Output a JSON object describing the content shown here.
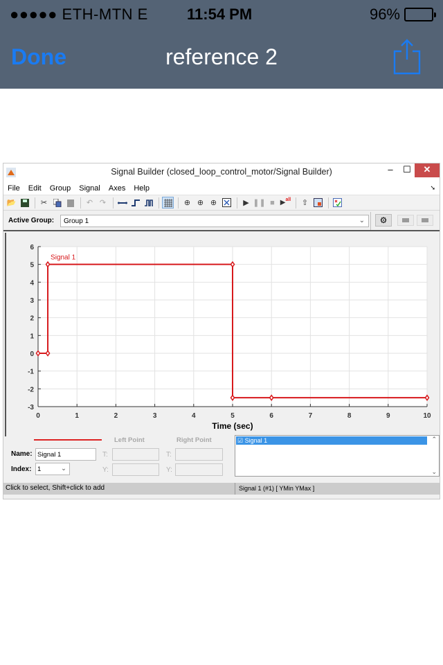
{
  "status_bar": {
    "carrier": "●●●●● ETH-MTN   E",
    "time": "11:54 PM",
    "battery": "96%",
    "battery_level": 0.96
  },
  "nav": {
    "done_label": "Done",
    "title": "reference 2"
  },
  "window": {
    "title": "Signal Builder (closed_loop_control_motor/Signal Builder)",
    "controls": {
      "minimize": "–",
      "maximize": "☐",
      "close": "✕"
    },
    "menu": [
      "File",
      "Edit",
      "Group",
      "Signal",
      "Axes",
      "Help"
    ],
    "toolbar_icons": [
      "open-icon",
      "save-icon",
      "cut-icon",
      "copy-icon",
      "paste-icon",
      "undo-icon",
      "redo-icon",
      "constant-icon",
      "step-icon",
      "pulse-icon",
      "grid-icon",
      "zoom-x-icon",
      "zoom-y-icon",
      "zoom-xy-icon",
      "fit-icon",
      "play-icon",
      "pause-icon",
      "stop-icon",
      "play-all-icon",
      "up-icon",
      "export-icon",
      "verify-icon"
    ],
    "active_group_label": "Active Group:",
    "active_group_value": "Group 1",
    "bottom": {
      "left_point_label": "Left Point",
      "right_point_label": "Right Point",
      "name_label": "Name:",
      "name_value": "Signal 1",
      "index_label": "Index:",
      "index_value": "1",
      "t_label": "T:",
      "y_label": "Y:",
      "signal_list": [
        "☑ Signal 1"
      ]
    },
    "status_left": "Click to select, Shift+click to add",
    "status_right": "Signal 1 (#1)  [ YMin YMax ]"
  },
  "chart_data": {
    "type": "line",
    "title": "",
    "xlabel": "Time (sec)",
    "ylabel": "",
    "xlim": [
      0,
      10
    ],
    "ylim": [
      -3,
      6
    ],
    "xticks": [
      0,
      1,
      2,
      3,
      4,
      5,
      6,
      7,
      8,
      9,
      10
    ],
    "yticks": [
      -3,
      -2,
      -1,
      0,
      1,
      2,
      3,
      4,
      5,
      6
    ],
    "grid": true,
    "series": [
      {
        "name": "Signal 1",
        "color": "#d7191c",
        "x": [
          0,
          0.25,
          0.25,
          5,
          5,
          6,
          10
        ],
        "y": [
          0,
          0,
          5,
          5,
          -2.5,
          -2.5,
          -2.5
        ]
      }
    ]
  }
}
